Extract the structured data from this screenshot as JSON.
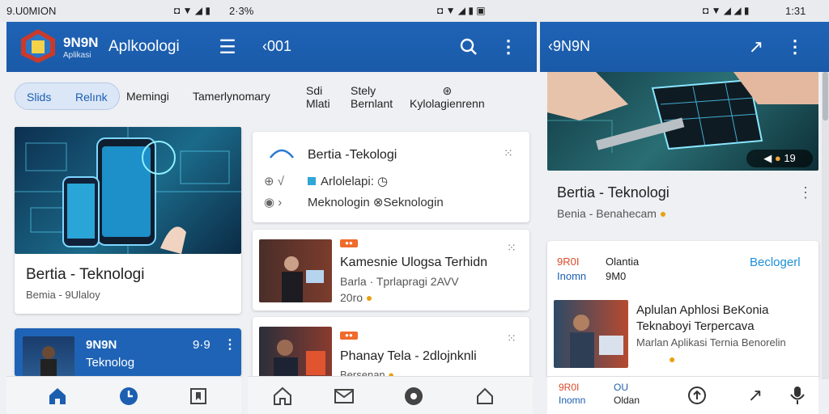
{
  "status": {
    "left_text": "9.U0MION",
    "mid_time": "2·3%",
    "right_time": "1:31"
  },
  "appbar_left": {
    "brand": "9N9N",
    "brand_sub": "Aplikasi",
    "title": "Aplkoologi",
    "back_label": "‹001"
  },
  "appbar_right": {
    "title": "‹9N9N"
  },
  "chips": [
    {
      "label1": "Slids",
      "label2": "Relınk"
    },
    {
      "label": "Memingi"
    },
    {
      "label": "Tamerlynomary"
    },
    {
      "label1": "Sdi",
      "label2": "Mlati"
    },
    {
      "label1": "Stely",
      "label2": "Bernlant"
    },
    {
      "label": "Kylolagienrenn"
    }
  ],
  "hero_card": {
    "title": "Bertia - Teknologi",
    "meta": "Bemia - 9Ulaloy"
  },
  "blue_card": {
    "brand": "9N9N",
    "title": "Teknolog",
    "stat": "9·9"
  },
  "top_card": {
    "title": "Bertia -Tekologi",
    "line1": "Arlolelapi:",
    "line2a": "Meknologin",
    "line2b": "Seknologin"
  },
  "list_items": [
    {
      "badge": "●●",
      "title": "Kamesnie Ulogsa Terhidn",
      "meta1": "Barla · Tprlapragi 2AVV",
      "meta2": "20ro"
    },
    {
      "badge": "●●",
      "title": "Phanay Tela - 2dlojnknli",
      "meta1": "Bersenan"
    }
  ],
  "right_hero": {
    "badge_stat": "19",
    "title": "Bertia - Teknologi",
    "meta": "Benia - Benahecam"
  },
  "right_card": {
    "tag1": "9R0I",
    "tag2": "Inomn",
    "col2a": "Olantia",
    "col2b": "9M0",
    "link": "Beclogerl",
    "article_title": "Aplulan Aphlosi BeKonia Teknaboyi Terpercava",
    "article_meta": "Marlan Aplikasi Ternia Benorelin"
  },
  "right_bottom": {
    "tag1": "9R0I",
    "tag2": "Inomn",
    "tag3a": "OU",
    "tag3b": "Oldan"
  },
  "colors": {
    "primary": "#1c5fb0",
    "accent": "#e8780f",
    "badge": "#f06a2c"
  }
}
